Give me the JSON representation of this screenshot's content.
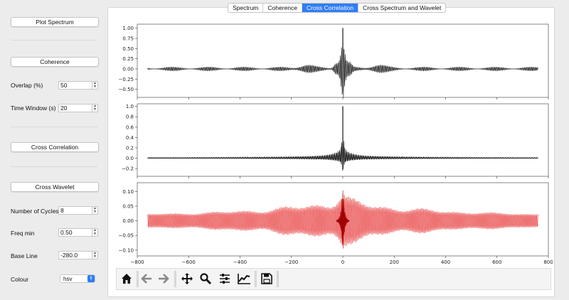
{
  "tabs": [
    {
      "label": "Spectrum",
      "active": false
    },
    {
      "label": "Coherence",
      "active": false
    },
    {
      "label": "Cross Correlation",
      "active": true
    },
    {
      "label": "Cross Spectrum and Wavelet",
      "active": false
    }
  ],
  "left": {
    "plot_spectrum": "Plot Spectrum",
    "coherence": "Coherence",
    "overlap_label": "Overlap (%)",
    "overlap_value": "50",
    "time_window_label": "Time Window (s)",
    "time_window_value": "20",
    "cross_correlation": "Cross Correlation",
    "cross_wavelet": "Cross Wavelet",
    "cycles_label": "Number of Cycles",
    "cycles_value": "8",
    "freq_min_label": "Freq min",
    "freq_min_value": "0.50",
    "base_line_label": "Base Line",
    "base_line_value": "-280.0",
    "colour_label": "Colour",
    "colour_value": "hsv"
  },
  "toolbar": {
    "icons": [
      "home-icon",
      "back-icon",
      "forward-icon",
      "pan-icon",
      "zoom-icon",
      "configure-subplots-icon",
      "edit-axis-icon",
      "save-icon"
    ]
  },
  "chart_data": [
    {
      "type": "line",
      "xlim": [
        -800,
        800
      ],
      "ylim": [
        -0.7,
        1.1
      ],
      "y_ticks": [
        "1.00",
        "0.75",
        "0.50",
        "0.25",
        "0.00",
        "−0.25",
        "−0.50"
      ],
      "x_range": [
        -760,
        760
      ],
      "color": "#000000",
      "peak": {
        "x": 0,
        "y": 1.0
      }
    },
    {
      "type": "line",
      "xlim": [
        -800,
        800
      ],
      "ylim": [
        -0.35,
        1.05
      ],
      "y_ticks": [
        "1.0",
        "0.8",
        "0.6",
        "0.4",
        "0.2",
        "0.0",
        "−0.2"
      ],
      "x_range": [
        -760,
        760
      ],
      "color": "#000000",
      "peak": {
        "x": 0,
        "y": 1.0
      }
    },
    {
      "type": "line",
      "xlim": [
        -800,
        800
      ],
      "ylim": [
        -0.12,
        0.13
      ],
      "y_ticks": [
        "0.10",
        "0.05",
        "0.00",
        "−0.05",
        "−0.10"
      ],
      "x_ticks": [
        "−800",
        "−600",
        "−400",
        "−200",
        "0",
        "200",
        "400",
        "600",
        "800"
      ],
      "x_range": [
        -760,
        760
      ],
      "color": "#e00000",
      "peak": {
        "x": 0,
        "y": 0.12
      }
    }
  ]
}
